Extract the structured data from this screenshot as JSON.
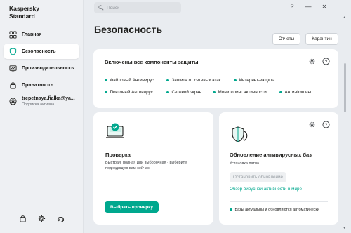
{
  "app": {
    "name_line1": "Kaspersky",
    "name_line2": "Standard"
  },
  "sidebar": {
    "items": [
      {
        "label": "Главная",
        "icon": "grid-icon"
      },
      {
        "label": "Безопасность",
        "icon": "shield-icon",
        "active": true
      },
      {
        "label": "Производительность",
        "icon": "speedometer-icon"
      },
      {
        "label": "Приватность",
        "icon": "lock-icon"
      }
    ],
    "account": {
      "email": "trepetnaya.fialka@ya...",
      "status": "Подписка активна"
    },
    "bottom_icons": [
      "bag-icon",
      "gear-icon",
      "headset-icon"
    ]
  },
  "topbar": {
    "search_placeholder": "Поиск",
    "help": "?",
    "minimize": "—",
    "close": "✕"
  },
  "header": {
    "title": "Безопасность",
    "reports_label": "Отчеты",
    "quarantine_label": "Карантин"
  },
  "protection": {
    "title": "Включены все компоненты защиты",
    "components": [
      "Файловый Антивирус",
      "Защита от сетевых атак",
      "Интернет-защита",
      "Почтовый Антивирус",
      "Сетевой экран",
      "Мониторинг активности",
      "Анти-Фишинг"
    ]
  },
  "scan": {
    "title": "Проверка",
    "description_line1": "Быстрая, полная или выборочная - выберите",
    "description_line2": "подходящую вам сейчас.",
    "button_label": "Выбрать проверку"
  },
  "update": {
    "title": "Обновление антивирусных баз",
    "status": "Установка патча...",
    "cancel_label": "Остановить обновление",
    "link_label": "Обзор вирусной активности в мире",
    "footer": "Базы актуальны и обновляются автоматически"
  },
  "colors": {
    "accent": "#00a88e",
    "sidebar_bg": "#eef0f3",
    "page_bg": "#e9ecf0"
  }
}
